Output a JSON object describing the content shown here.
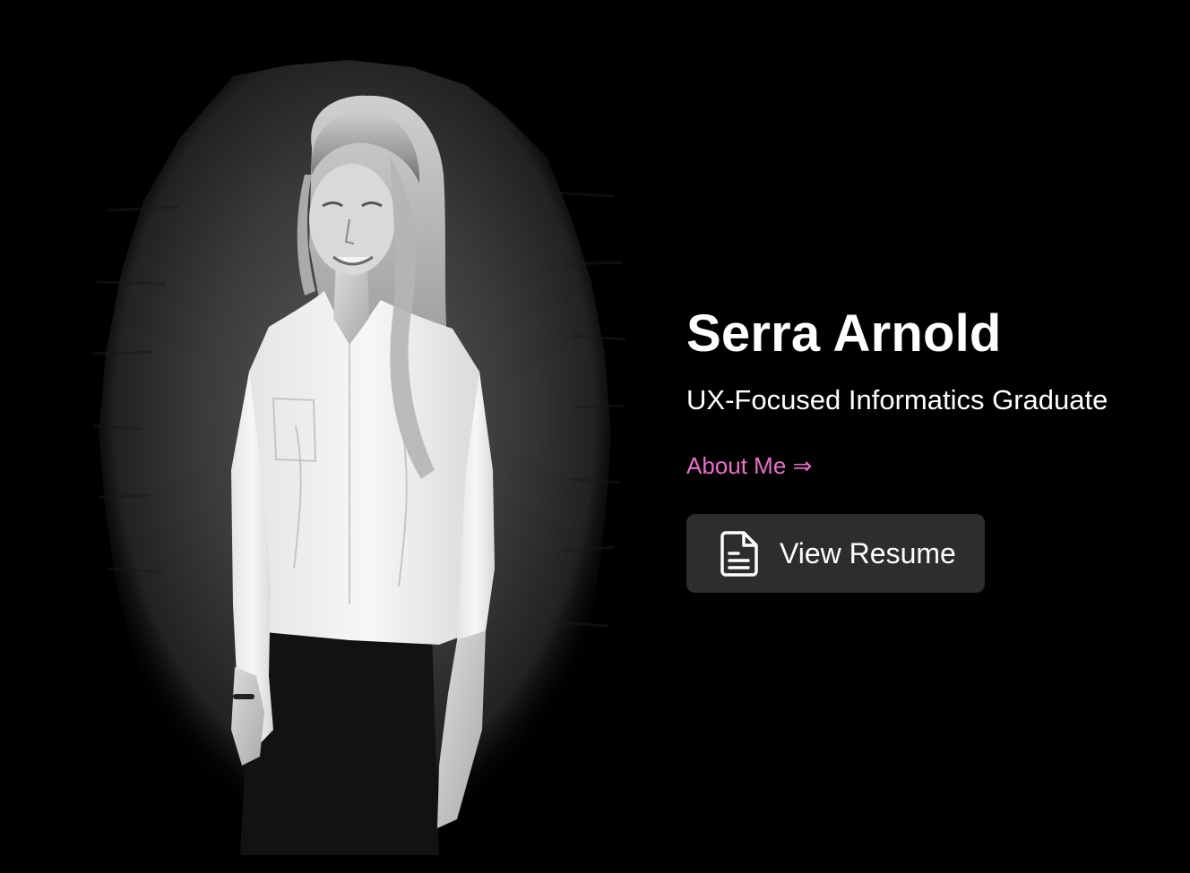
{
  "hero": {
    "name": "Serra Arnold",
    "tagline": "UX-Focused Informatics Graduate",
    "about_link": "About Me ⇒",
    "resume_button": {
      "label": "View Resume",
      "icon": "document-icon"
    }
  },
  "portrait": {
    "icon": "profile-photo",
    "style": "black-and-white photo on a brush-stroke gray backdrop"
  },
  "colors": {
    "background": "#000000",
    "text": "#ffffff",
    "accent_link": "#e96fc8",
    "button_bg": "#2d2d2d"
  }
}
